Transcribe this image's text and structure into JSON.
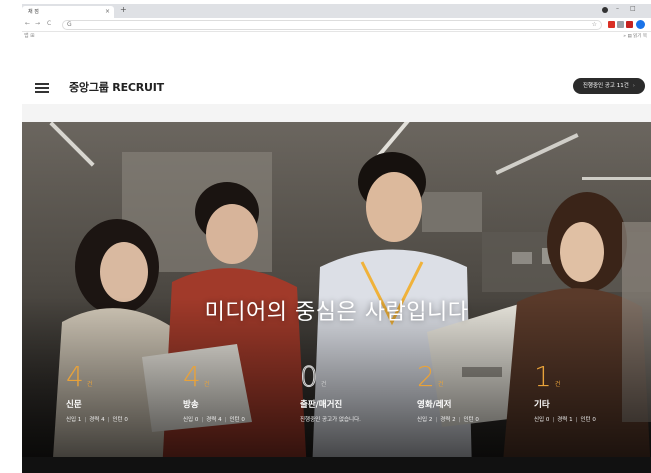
{
  "browser": {
    "tab_title": "채 점",
    "tab_close": "×",
    "new_tab": "+",
    "win_minimize": "–",
    "win_maximize": "□",
    "nav_back": "←",
    "nav_forward": "→",
    "nav_reload": "C",
    "address_icon": "G",
    "bookmark_left": "앱 ⊞",
    "bookmark_right": "» ▤ 읽기 목"
  },
  "header": {
    "logo": "중앙그룹 RECRUIT",
    "postings_button": "진행중인 공고 11건",
    "postings_chevron": "›"
  },
  "hero": {
    "title": "미디어의 중심은 사람입니다"
  },
  "stats": [
    {
      "count": "4",
      "unit": "건",
      "name": "신문",
      "detail": [
        "신입 1",
        "경력 4",
        "인턴 0"
      ]
    },
    {
      "count": "4",
      "unit": "건",
      "name": "방송",
      "detail": [
        "신입 0",
        "경력 4",
        "인턴 0"
      ]
    },
    {
      "count": "0",
      "unit": "건",
      "name": "출판/매거진",
      "detail": [
        "진행중인 공고가 없습니다."
      ]
    },
    {
      "count": "2",
      "unit": "건",
      "name": "영화/레저",
      "detail": [
        "신입 2",
        "경력 2",
        "인턴 0"
      ]
    },
    {
      "count": "1",
      "unit": "건",
      "name": "기타",
      "detail": [
        "신입 0",
        "경력 1",
        "인턴 0"
      ]
    }
  ],
  "colors": {
    "accent": "#e8a23a",
    "header_button": "#2b2b2b",
    "profile": "#1a73e8"
  }
}
